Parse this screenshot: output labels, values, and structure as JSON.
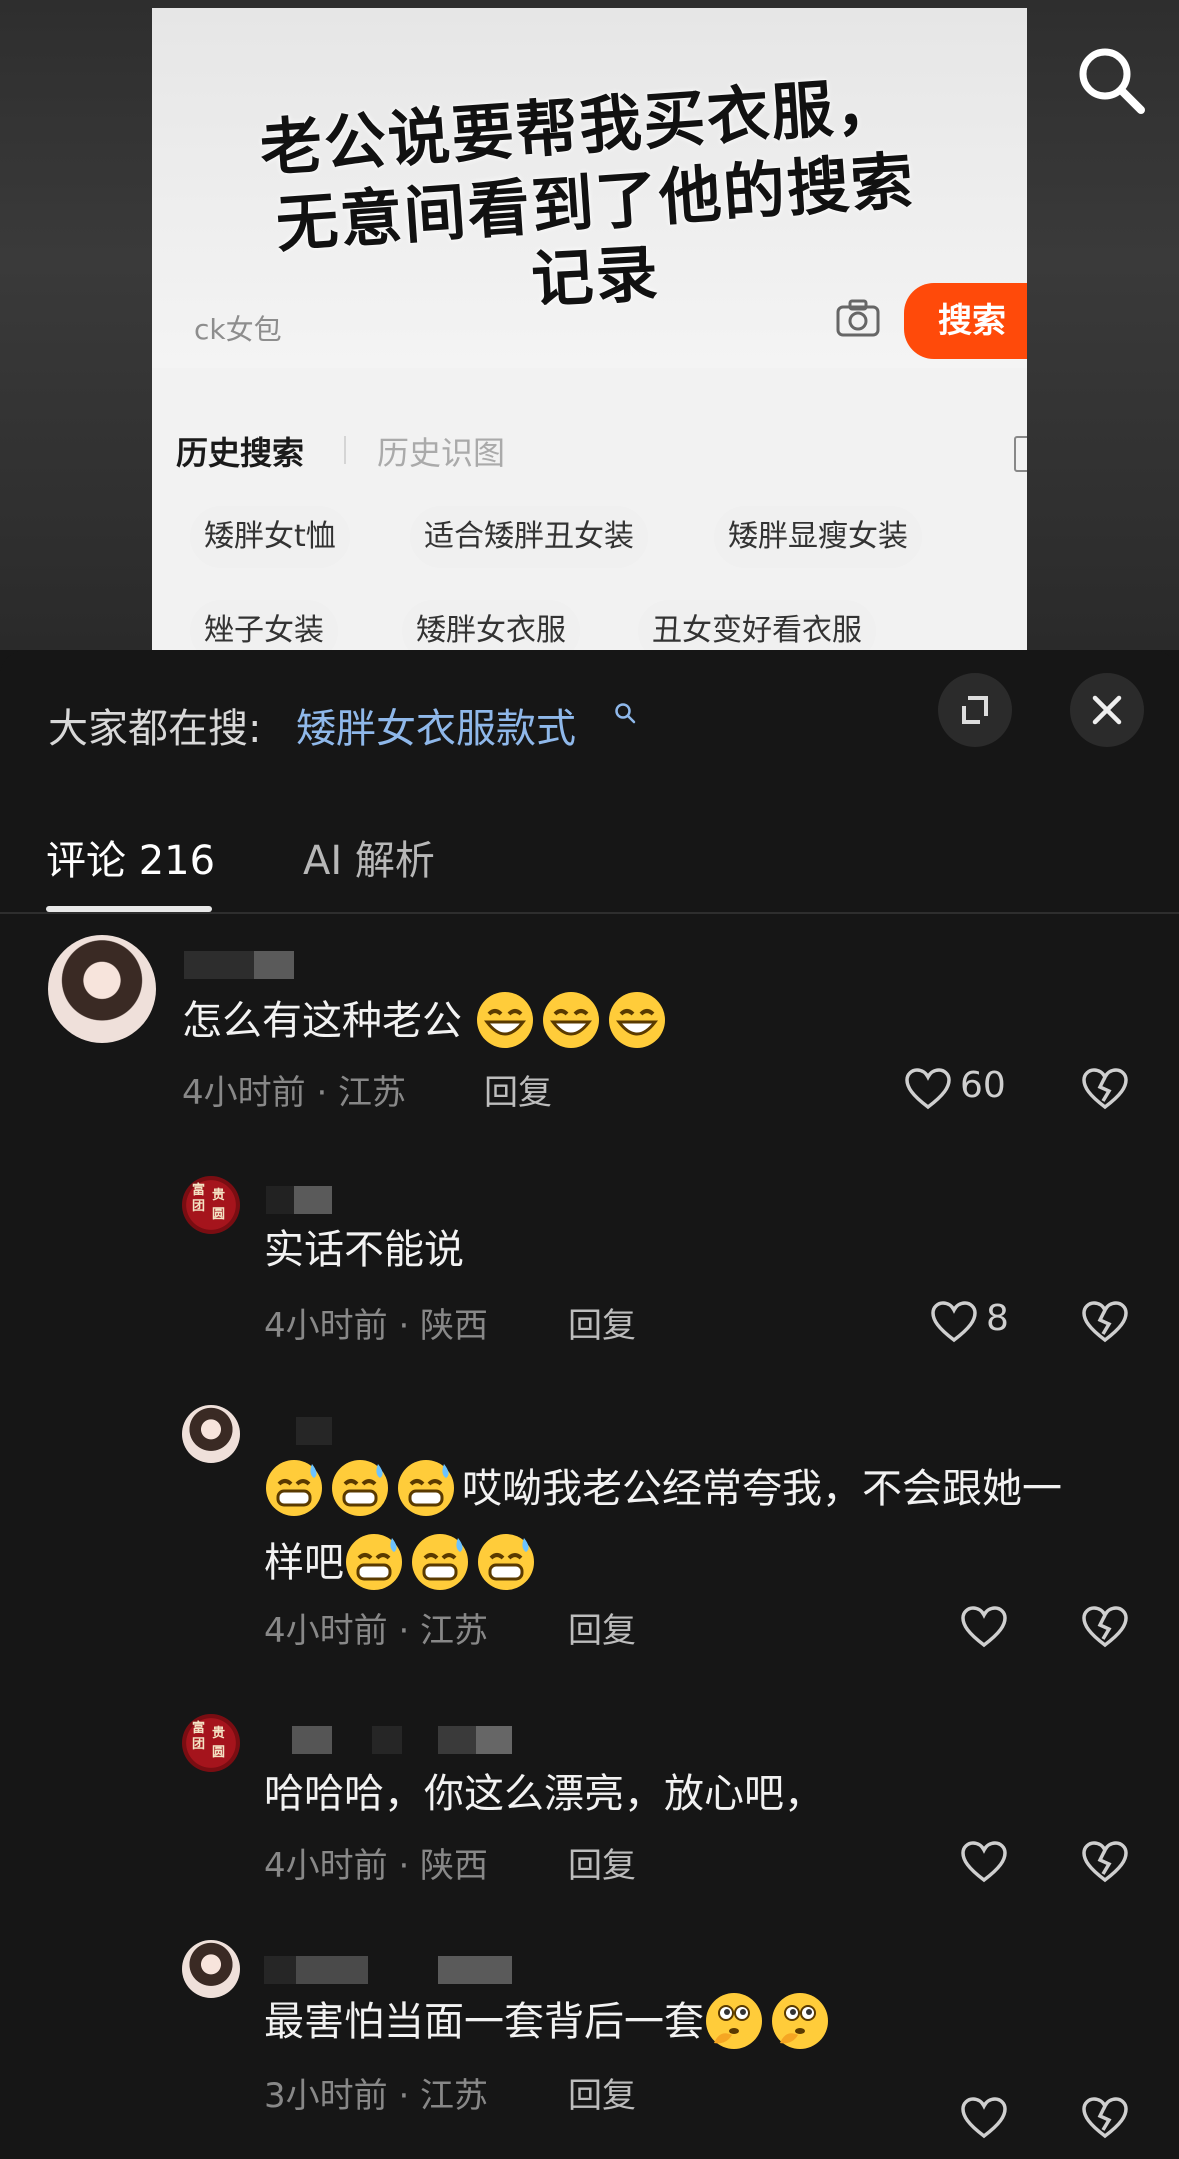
{
  "video": {
    "headline_line1": "老公说要帮我买衣服，",
    "headline_line2": "无意间看到了他的搜索",
    "headline_line3": "记录",
    "search_query": "ck女包",
    "search_button": "搜索",
    "history_tab": "历史搜索",
    "image_history_tab": "历史识图",
    "chips": [
      "矮胖女t恤",
      "适合矮胖丑女装",
      "矮胖显瘦女装",
      "矬子女装",
      "矮胖女衣服",
      "丑女变好看衣服"
    ]
  },
  "sheet": {
    "everyone_searching_label": "大家都在搜:",
    "everyone_searching_query": "矮胖女衣服款式",
    "tabs": {
      "comments": "评论 216",
      "ai": "AI 解析"
    }
  },
  "comments": [
    {
      "text": "怎么有这种老公",
      "emoji": "grinning-face-emoji",
      "emoji_count": 3,
      "time": "4小时前 · 江苏",
      "reply": "回复",
      "likes": "60"
    },
    {
      "text": "实话不能说",
      "time": "4小时前 · 陕西",
      "reply": "回复",
      "likes": "8"
    },
    {
      "line1_text": "哎呦我老公经常夸我，不会跟她一",
      "line2_text": "样吧",
      "emoji": "grinning-sweat-emoji",
      "time": "4小时前 · 江苏",
      "reply": "回复"
    },
    {
      "text": "哈哈哈，你这么漂亮，放心吧，",
      "time": "4小时前 · 陕西",
      "reply": "回复"
    },
    {
      "text": "最害怕当面一套背后一套",
      "emoji": "thinking-face-emoji",
      "time": "3小时前 · 江苏",
      "reply": "回复"
    }
  ],
  "seal_avatar": [
    "富",
    "贵",
    "团",
    "圆"
  ],
  "colors": {
    "accent_search": "#ff4a0a",
    "query_link": "#8fb8ea",
    "sheet_bg": "#161616"
  }
}
